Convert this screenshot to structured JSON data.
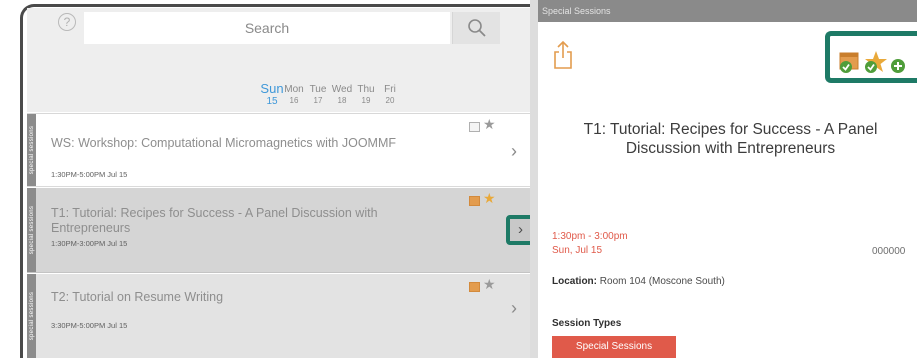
{
  "search": {
    "placeholder": "Search",
    "help_glyph": "?"
  },
  "days": [
    {
      "name": "Sun",
      "num": "15",
      "active": true
    },
    {
      "name": "Mon",
      "num": "16"
    },
    {
      "name": "Tue",
      "num": "17"
    },
    {
      "name": "Wed",
      "num": "18"
    },
    {
      "name": "Thu",
      "num": "19"
    },
    {
      "name": "Fri",
      "num": "20"
    }
  ],
  "sessions": [
    {
      "tab": "special sessions",
      "title": "WS: Workshop: Computational Micromagnetics with JOOMMF",
      "time": "1:30PM-5:00PM Jul 15",
      "starred": false
    },
    {
      "tab": "special sessions",
      "title": "T1: Tutorial: Recipes for Success - A Panel Discussion with Entrepreneurs",
      "time": "1:30PM-3:00PM Jul 15",
      "starred": true,
      "selected": true
    },
    {
      "tab": "special sessions",
      "title": "T2: Tutorial on Resume Writing",
      "time": "3:30PM-5:00PM Jul 15",
      "starred": true
    }
  ],
  "detail": {
    "header": "Special Sessions",
    "title": "T1: Tutorial: Recipes for Success - A Panel Discussion with Entrepreneurs",
    "time_range": "1:30pm - 3:00pm",
    "date": "Sun, Jul 15",
    "code": "000000",
    "location_label": "Location:",
    "location_value": "Room 104 (Moscone South)",
    "types_label": "Session Types",
    "type_badge": "Special Sessions"
  },
  "icons": {
    "chevron": "›",
    "star": "★"
  },
  "colors": {
    "accent_blue": "#3f98d9",
    "highlight_green": "#1e7a66",
    "time_red": "#e05a4a",
    "star_gold": "#e9a93a",
    "calendar_orange": "#e39c4e"
  }
}
